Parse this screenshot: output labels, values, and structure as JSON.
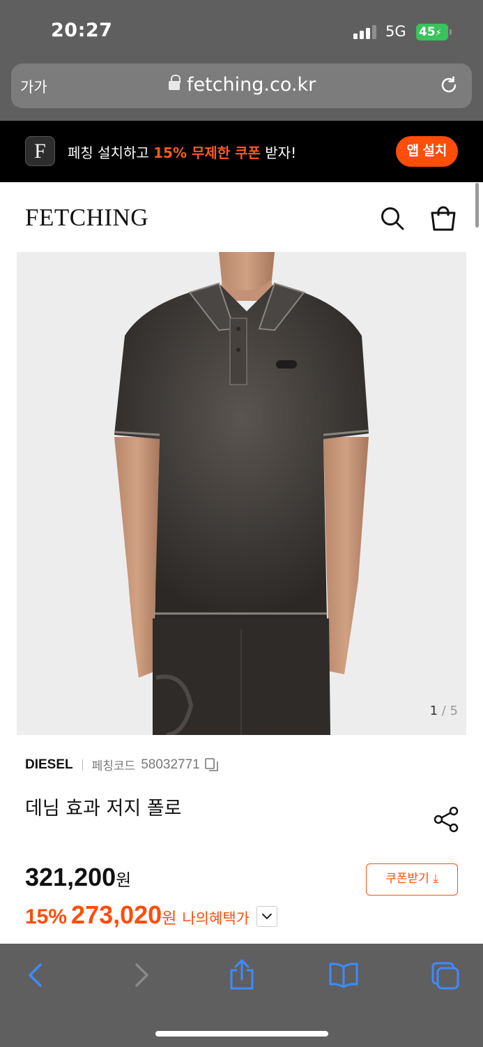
{
  "status_bar": {
    "time": "20:27",
    "network": "5G",
    "battery": "45"
  },
  "browser": {
    "text_size_label": "가가",
    "url": "fetching.co.kr"
  },
  "app_banner": {
    "icon_letter": "F",
    "text_before": "페칭 설치하고 ",
    "text_highlight": "15% 무제한 쿠폰",
    "text_after": " 받자!",
    "install_label": "앱 설치",
    "accent_color": "#ff4d0a"
  },
  "header": {
    "logo": "FETCHING",
    "icons": [
      "search-icon",
      "shopping-bag-icon"
    ]
  },
  "gallery": {
    "current": "1",
    "separator": " / ",
    "total": "5"
  },
  "product": {
    "brand": "DIESEL",
    "code_label": "페칭코드",
    "code": "58032771",
    "title": "데님 효과 저지 폴로",
    "original_price": "321,200",
    "currency": "원",
    "coupon_label": "쿠폰받기",
    "discount_percent": "15%",
    "sale_price": "273,020",
    "my_benefit_label": "나의혜택가"
  },
  "toolbar": {
    "icons": [
      "back-icon",
      "forward-icon",
      "share-icon",
      "bookmarks-icon",
      "tabs-icon"
    ]
  }
}
